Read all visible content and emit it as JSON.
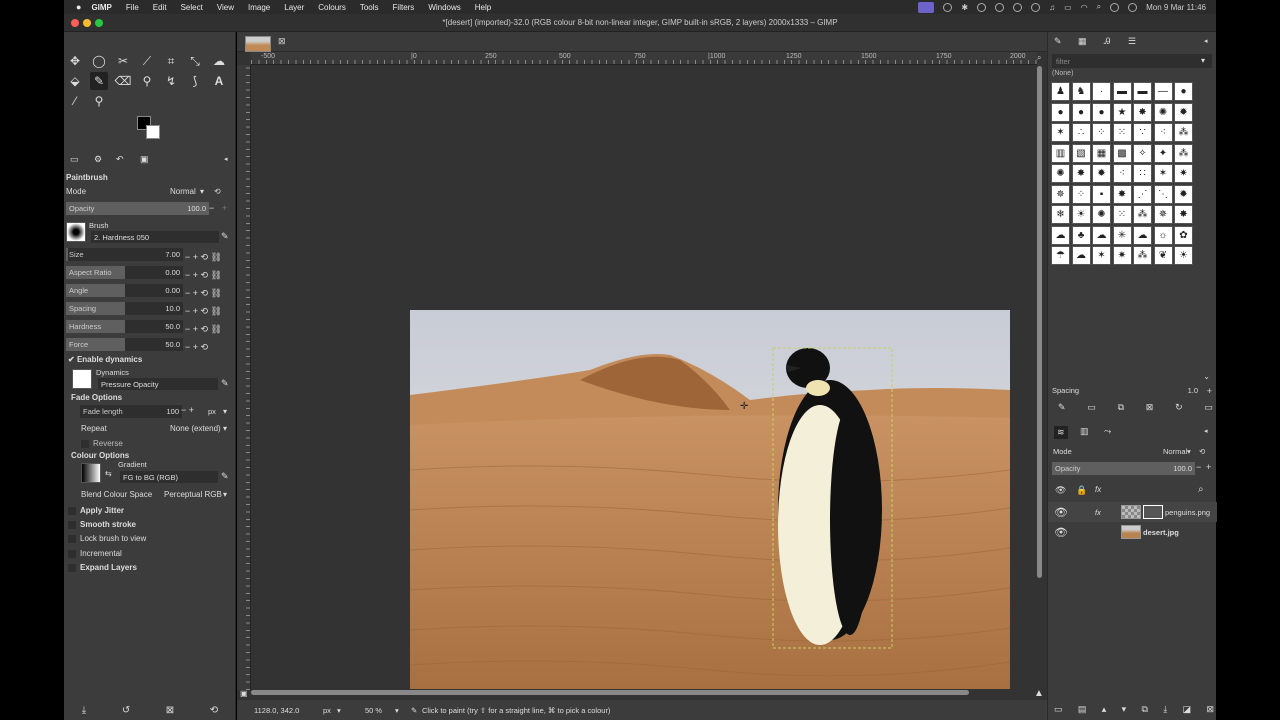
{
  "menubar": {
    "apple": "",
    "app": "GIMP",
    "items": [
      "File",
      "Edit",
      "Select",
      "View",
      "Image",
      "Layer",
      "Colours",
      "Tools",
      "Filters",
      "Windows",
      "Help"
    ],
    "clock": "Mon 9 Mar  11:46"
  },
  "title": "*[desert] (imported)-32.0 (RGB colour 8-bit non-linear integer, GIMP built-in sRGB, 2 layers) 2000x1333 – GIMP",
  "tool_options": {
    "heading": "Paintbrush",
    "mode_label": "Mode",
    "mode_value": "Normal",
    "opacity_label": "Opacity",
    "opacity_value": "100.0",
    "opacity_fraction": 1.0,
    "brush_label": "Brush",
    "brush_name": "2. Hardness 050",
    "size": {
      "label": "Size",
      "value": "7.00",
      "fraction": 0.02
    },
    "aspect": {
      "label": "Aspect Ratio",
      "value": "0.00",
      "fraction": 0.5
    },
    "angle": {
      "label": "Angle",
      "value": "0.00",
      "fraction": 0.5
    },
    "spacing": {
      "label": "Spacing",
      "value": "10.0",
      "fraction": 0.5
    },
    "hardness": {
      "label": "Hardness",
      "value": "50.0",
      "fraction": 0.5
    },
    "force": {
      "label": "Force",
      "value": "50.0",
      "fraction": 0.5
    },
    "enable_dynamics": "Enable dynamics",
    "dynamics_label": "Dynamics",
    "dynamics_value": "Pressure Opacity",
    "fade_options": "Fade Options",
    "fade_length_label": "Fade length",
    "fade_length_value": "100",
    "fade_unit": "px",
    "repeat_label": "Repeat",
    "repeat_value": "None (extend)",
    "reverse": "Reverse",
    "colour_options": "Colour Options",
    "gradient_label": "Gradient",
    "gradient_value": "FG to BG (RGB)",
    "blend_label": "Blend Colour Space",
    "blend_value": "Perceptual RGB",
    "apply_jitter": "Apply Jitter",
    "smooth_stroke": "Smooth stroke",
    "lock_brush": "Lock brush to view",
    "incremental": "Incremental",
    "expand_layers": "Expand Layers"
  },
  "ruler": {
    "ticks": [
      "-500",
      "|0",
      "250",
      "500",
      "750",
      "|1000",
      "1250",
      "1500",
      "1750",
      "2000"
    ]
  },
  "status": {
    "coords": "1128.0, 342.0",
    "unit": "px",
    "zoom": "50 %",
    "message": "Click to paint (try ⇧ for a straight line, ⌘ to pick a colour)"
  },
  "brushes": {
    "filter_placeholder": "filter",
    "tag": "(None)",
    "spacing_label": "Spacing",
    "spacing_value": "1.0"
  },
  "layers": {
    "mode_label": "Mode",
    "mode_value": "Normal",
    "opacity_label": "Opacity",
    "opacity_value": "100.0",
    "items": [
      {
        "name": "penguins.png"
      },
      {
        "name": "desert.jpg"
      }
    ]
  },
  "colors": {
    "panel": "#3c3c3c",
    "canvas": "#333333",
    "accent": "#6b63c9"
  }
}
